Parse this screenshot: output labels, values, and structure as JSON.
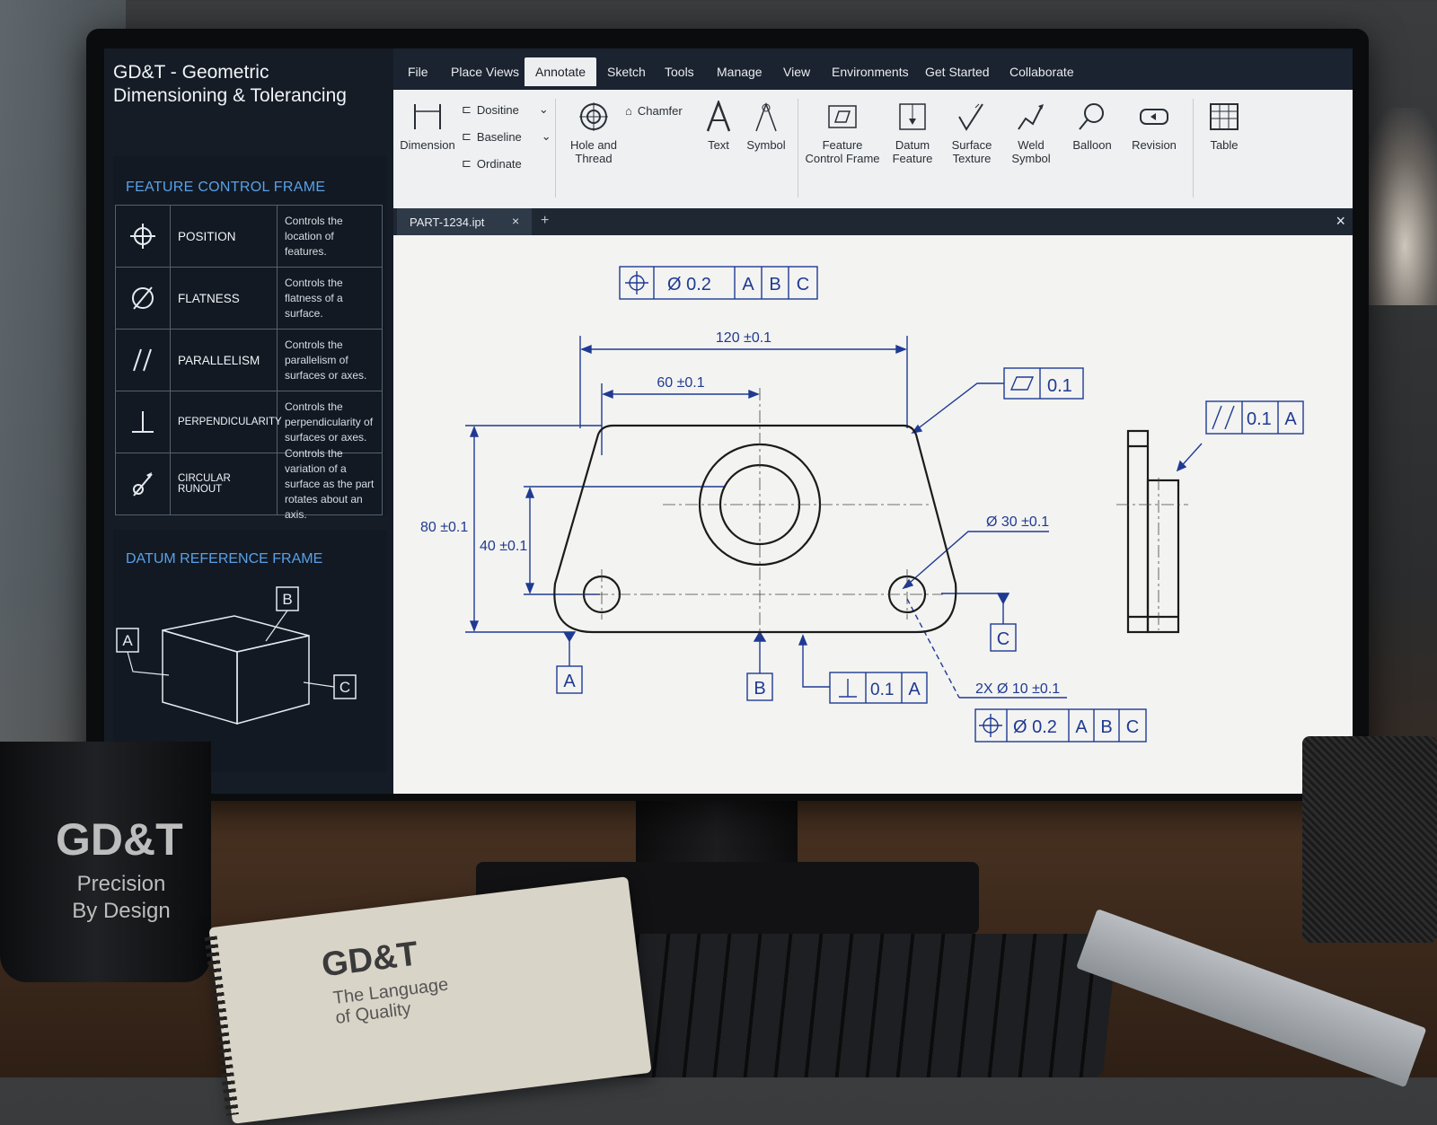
{
  "app": {
    "title": "GD&T - Geometric Dimensioning & Tolerancing"
  },
  "left_panel": {
    "fcf_header": "FEATURE CONTROL FRAME",
    "fcf_rows": [
      {
        "icon": "position-icon",
        "name": "POSITION",
        "desc": "Controls the location of features."
      },
      {
        "icon": "flatness-icon",
        "name": "FLATNESS",
        "desc": "Controls the flatness of a surface."
      },
      {
        "icon": "parallelism-icon",
        "name": "PARALLELISM",
        "desc": "Controls the parallelism of surfaces or axes."
      },
      {
        "icon": "perpendicularity-icon",
        "name": "PERPENDICULARITY",
        "desc": "Controls the perpendicularity of surfaces or axes."
      },
      {
        "icon": "circular-runout-icon",
        "name": "CIRCULAR RUNOUT",
        "desc": "Controls the variation of a surface as the part rotates about an axis."
      }
    ],
    "datum_header": "DATUM REFERENCE FRAME",
    "datum_labels": {
      "a": "A",
      "b": "B",
      "c": "C"
    }
  },
  "menu": {
    "items": [
      "File",
      "Place Views",
      "Annotate",
      "Sketch",
      "Tools",
      "Manage",
      "View",
      "Environments",
      "Get Started",
      "Collaborate"
    ],
    "active": "Annotate"
  },
  "ribbon": {
    "dimension": "Dimension",
    "dositine": "Dositine",
    "baseline": "Baseline",
    "ordinate": "Ordinate",
    "hole_thread_1": "Hole and",
    "hole_thread_2": "Thread",
    "chamfer": "Chamfer",
    "text": "Text",
    "symbol": "Symbol",
    "fcf_1": "Feature",
    "fcf_2": "Control Frame",
    "datum_1": "Datum",
    "datum_2": "Feature",
    "surface_1": "Surface",
    "surface_2": "Texture",
    "weld_1": "Weld",
    "weld_2": "Symbol",
    "balloon": "Balloon",
    "revision": "Revision",
    "table": "Table"
  },
  "tabs": {
    "document": "PART-1234.ipt",
    "close": "×",
    "add": "+"
  },
  "drawing": {
    "top_fcf": {
      "value": "Ø 0.2",
      "datums": [
        "A",
        "B",
        "C"
      ]
    },
    "dim_120": "120 ±0.1",
    "dim_60": "60 ±0.1",
    "dim_80": "80 ±0.1",
    "dim_40": "40 ±0.1",
    "flatness_fcf": "0.1",
    "parallel_fcf": {
      "value": "0.1",
      "datum": "A"
    },
    "dia_30": "Ø 30 ±0.1",
    "perp_fcf": {
      "value": "0.1",
      "datum": "A"
    },
    "two_holes": "2X Ø 10 ±0.1",
    "bottom_fcf": {
      "value": "Ø 0.2",
      "datums": [
        "A",
        "B",
        "C"
      ]
    },
    "datum_a": "A",
    "datum_b": "B",
    "datum_c": "C"
  },
  "desk": {
    "mug_title": "GD&T",
    "mug_line1": "Precision",
    "mug_line2": "By Design",
    "notebook_title": "GD&T",
    "notebook_sub1": "The Language",
    "notebook_sub2": "of Quality"
  },
  "colors": {
    "panel_bg": "#151c26",
    "accent_blue": "#5aa0e6",
    "drawing_blue": "#1f3a93",
    "ribbon_bg": "#eef0f2"
  }
}
